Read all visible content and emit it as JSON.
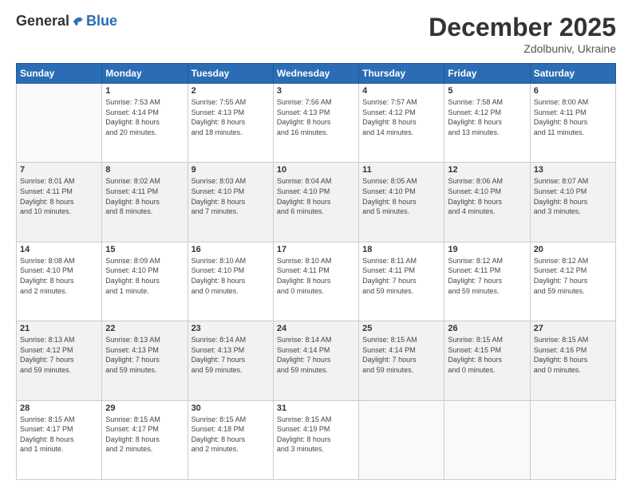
{
  "header": {
    "logo_general": "General",
    "logo_blue": "Blue",
    "month": "December 2025",
    "location": "Zdolbuniv, Ukraine"
  },
  "days_of_week": [
    "Sunday",
    "Monday",
    "Tuesday",
    "Wednesday",
    "Thursday",
    "Friday",
    "Saturday"
  ],
  "weeks": [
    [
      {
        "day": "",
        "info": ""
      },
      {
        "day": "1",
        "info": "Sunrise: 7:53 AM\nSunset: 4:14 PM\nDaylight: 8 hours\nand 20 minutes."
      },
      {
        "day": "2",
        "info": "Sunrise: 7:55 AM\nSunset: 4:13 PM\nDaylight: 8 hours\nand 18 minutes."
      },
      {
        "day": "3",
        "info": "Sunrise: 7:56 AM\nSunset: 4:13 PM\nDaylight: 8 hours\nand 16 minutes."
      },
      {
        "day": "4",
        "info": "Sunrise: 7:57 AM\nSunset: 4:12 PM\nDaylight: 8 hours\nand 14 minutes."
      },
      {
        "day": "5",
        "info": "Sunrise: 7:58 AM\nSunset: 4:12 PM\nDaylight: 8 hours\nand 13 minutes."
      },
      {
        "day": "6",
        "info": "Sunrise: 8:00 AM\nSunset: 4:11 PM\nDaylight: 8 hours\nand 11 minutes."
      }
    ],
    [
      {
        "day": "7",
        "info": "Sunrise: 8:01 AM\nSunset: 4:11 PM\nDaylight: 8 hours\nand 10 minutes."
      },
      {
        "day": "8",
        "info": "Sunrise: 8:02 AM\nSunset: 4:11 PM\nDaylight: 8 hours\nand 8 minutes."
      },
      {
        "day": "9",
        "info": "Sunrise: 8:03 AM\nSunset: 4:10 PM\nDaylight: 8 hours\nand 7 minutes."
      },
      {
        "day": "10",
        "info": "Sunrise: 8:04 AM\nSunset: 4:10 PM\nDaylight: 8 hours\nand 6 minutes."
      },
      {
        "day": "11",
        "info": "Sunrise: 8:05 AM\nSunset: 4:10 PM\nDaylight: 8 hours\nand 5 minutes."
      },
      {
        "day": "12",
        "info": "Sunrise: 8:06 AM\nSunset: 4:10 PM\nDaylight: 8 hours\nand 4 minutes."
      },
      {
        "day": "13",
        "info": "Sunrise: 8:07 AM\nSunset: 4:10 PM\nDaylight: 8 hours\nand 3 minutes."
      }
    ],
    [
      {
        "day": "14",
        "info": "Sunrise: 8:08 AM\nSunset: 4:10 PM\nDaylight: 8 hours\nand 2 minutes."
      },
      {
        "day": "15",
        "info": "Sunrise: 8:09 AM\nSunset: 4:10 PM\nDaylight: 8 hours\nand 1 minute."
      },
      {
        "day": "16",
        "info": "Sunrise: 8:10 AM\nSunset: 4:10 PM\nDaylight: 8 hours\nand 0 minutes."
      },
      {
        "day": "17",
        "info": "Sunrise: 8:10 AM\nSunset: 4:11 PM\nDaylight: 8 hours\nand 0 minutes."
      },
      {
        "day": "18",
        "info": "Sunrise: 8:11 AM\nSunset: 4:11 PM\nDaylight: 7 hours\nand 59 minutes."
      },
      {
        "day": "19",
        "info": "Sunrise: 8:12 AM\nSunset: 4:11 PM\nDaylight: 7 hours\nand 59 minutes."
      },
      {
        "day": "20",
        "info": "Sunrise: 8:12 AM\nSunset: 4:12 PM\nDaylight: 7 hours\nand 59 minutes."
      }
    ],
    [
      {
        "day": "21",
        "info": "Sunrise: 8:13 AM\nSunset: 4:12 PM\nDaylight: 7 hours\nand 59 minutes."
      },
      {
        "day": "22",
        "info": "Sunrise: 8:13 AM\nSunset: 4:13 PM\nDaylight: 7 hours\nand 59 minutes."
      },
      {
        "day": "23",
        "info": "Sunrise: 8:14 AM\nSunset: 4:13 PM\nDaylight: 7 hours\nand 59 minutes."
      },
      {
        "day": "24",
        "info": "Sunrise: 8:14 AM\nSunset: 4:14 PM\nDaylight: 7 hours\nand 59 minutes."
      },
      {
        "day": "25",
        "info": "Sunrise: 8:15 AM\nSunset: 4:14 PM\nDaylight: 7 hours\nand 59 minutes."
      },
      {
        "day": "26",
        "info": "Sunrise: 8:15 AM\nSunset: 4:15 PM\nDaylight: 8 hours\nand 0 minutes."
      },
      {
        "day": "27",
        "info": "Sunrise: 8:15 AM\nSunset: 4:16 PM\nDaylight: 8 hours\nand 0 minutes."
      }
    ],
    [
      {
        "day": "28",
        "info": "Sunrise: 8:15 AM\nSunset: 4:17 PM\nDaylight: 8 hours\nand 1 minute."
      },
      {
        "day": "29",
        "info": "Sunrise: 8:15 AM\nSunset: 4:17 PM\nDaylight: 8 hours\nand 2 minutes."
      },
      {
        "day": "30",
        "info": "Sunrise: 8:15 AM\nSunset: 4:18 PM\nDaylight: 8 hours\nand 2 minutes."
      },
      {
        "day": "31",
        "info": "Sunrise: 8:15 AM\nSunset: 4:19 PM\nDaylight: 8 hours\nand 3 minutes."
      },
      {
        "day": "",
        "info": ""
      },
      {
        "day": "",
        "info": ""
      },
      {
        "day": "",
        "info": ""
      }
    ]
  ]
}
